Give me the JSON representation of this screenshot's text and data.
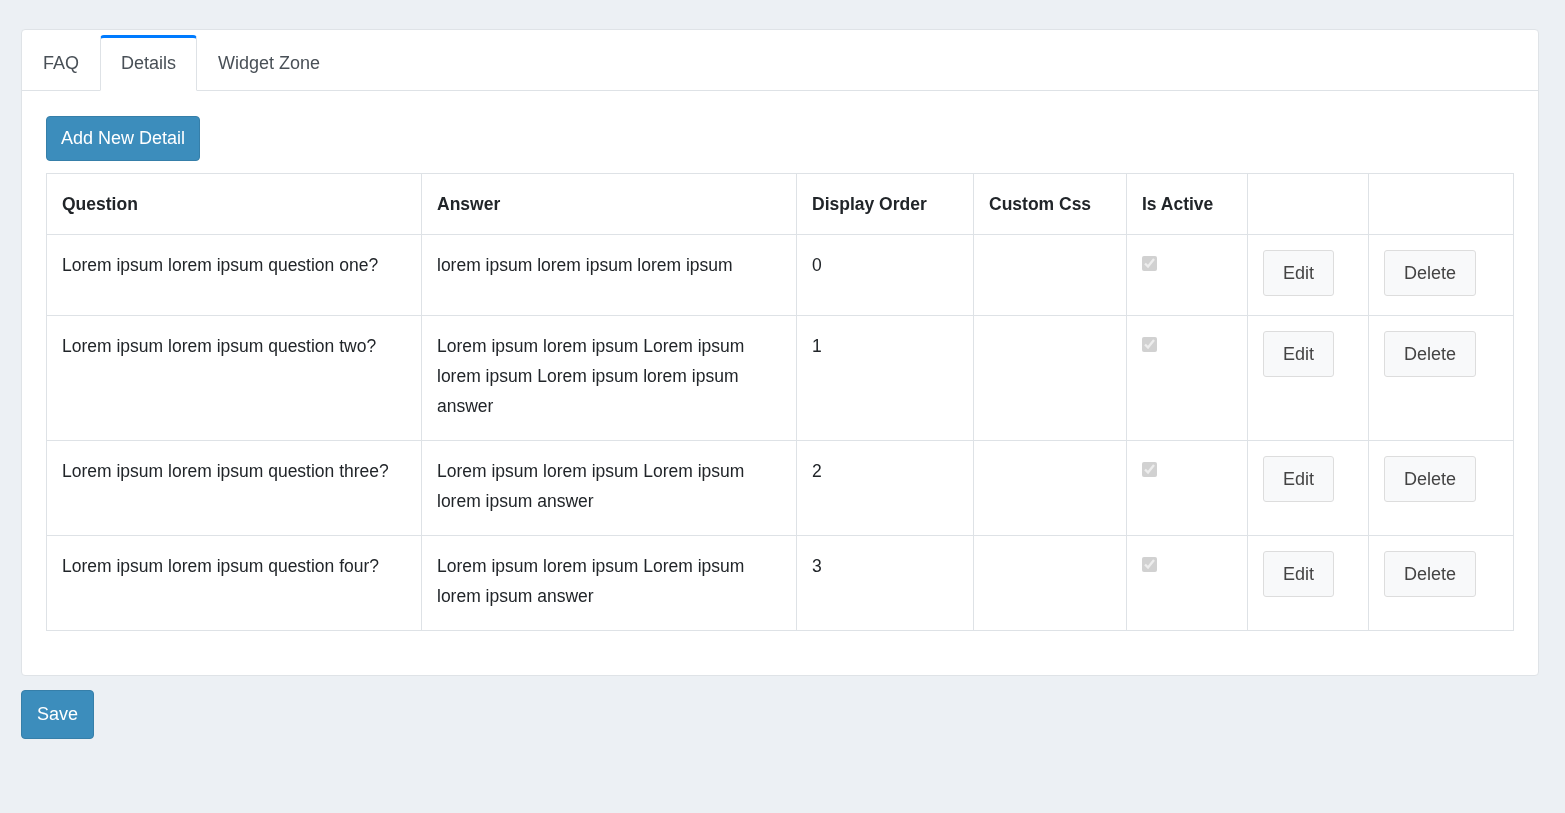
{
  "tabs": [
    {
      "label": "FAQ",
      "selected": false
    },
    {
      "label": "Details",
      "selected": true
    },
    {
      "label": "Widget Zone",
      "selected": false
    }
  ],
  "add_button": "Add New Detail",
  "table": {
    "columns": [
      "Question",
      "Answer",
      "Display Order",
      "Custom Css",
      "Is Active"
    ],
    "rows": [
      {
        "question": "Lorem ipsum lorem ipsum question one?",
        "answer": "lorem ipsum lorem ipsum lorem ipsum",
        "display_order": "0",
        "is_active": true,
        "disabled": true,
        "edit": "Edit",
        "delete": "Delete"
      },
      {
        "question": "Lorem ipsum lorem ipsum question two?",
        "answer": "Lorem ipsum lorem ipsum Lorem ipsum lorem ipsum Lorem ipsum lorem ipsum answer",
        "display_order": "1",
        "is_active": true,
        "disabled": true,
        "edit": "Edit",
        "delete": "Delete"
      },
      {
        "question": "Lorem ipsum lorem ipsum question three?",
        "answer": "Lorem ipsum lorem ipsum Lorem ipsum lorem ipsum answer",
        "display_order": "2",
        "is_active": true,
        "disabled": true,
        "edit": "Edit",
        "delete": "Delete"
      },
      {
        "question": "Lorem ipsum lorem ipsum question four?",
        "answer": "Lorem ipsum lorem ipsum Lorem ipsum lorem ipsum answer",
        "display_order": "3",
        "is_active": true,
        "disabled": true,
        "edit": "Edit",
        "delete": "Delete"
      }
    ]
  },
  "save_button": "Save"
}
